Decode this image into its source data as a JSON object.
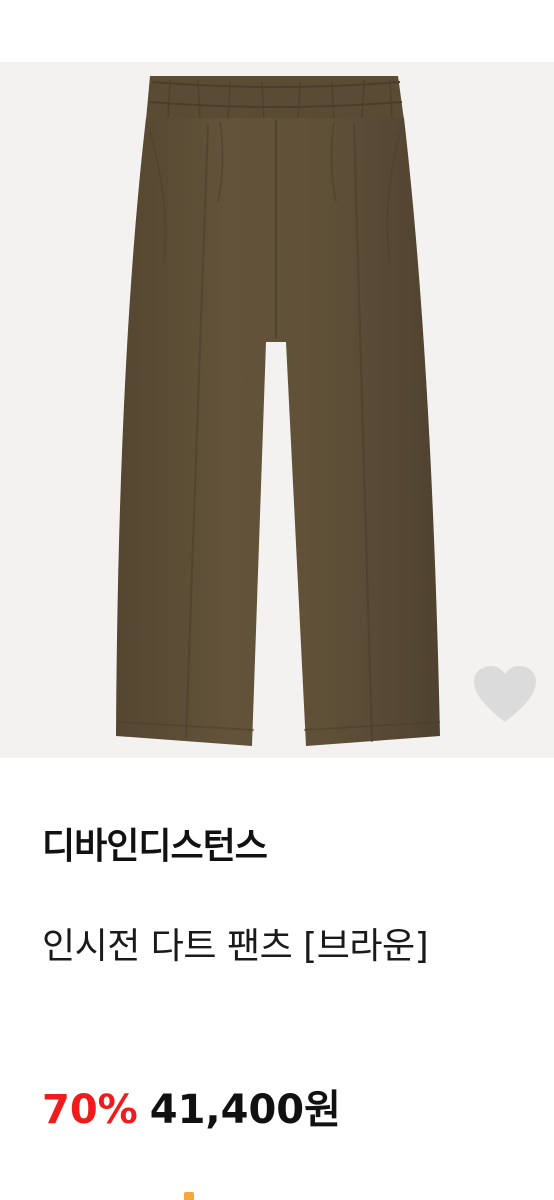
{
  "product": {
    "brand": "디바인디스턴스",
    "title": "인시전 다트 팬츠 [브라운]",
    "discount": "70%",
    "price": "41,400원"
  },
  "image": {
    "description_icon": "pants-product-image",
    "garment_color": "#5c4d36",
    "background_color": "#f3f2f0"
  },
  "wishlist": {
    "icon": "heart-icon",
    "icon_color": "#d9d9d9"
  },
  "colors": {
    "discount": "#f21a1a",
    "text": "#111111"
  }
}
